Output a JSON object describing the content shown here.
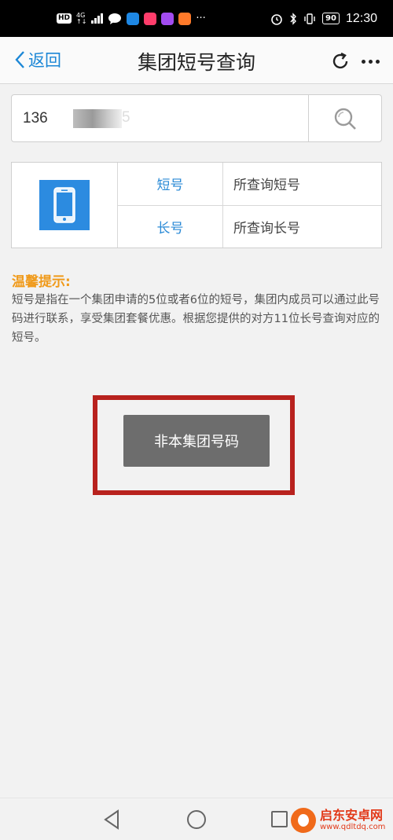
{
  "status_bar": {
    "hd_badge": "HD",
    "network_top": "4G",
    "network_bottom": "↑↓",
    "more_dots": "···",
    "battery": "90",
    "time": "12:30",
    "app_colors": [
      "#1e88e5",
      "#ff3d6b",
      "#a24cf0",
      "#ff7a2a"
    ]
  },
  "nav": {
    "back_label": "返回",
    "title": "集团短号查询"
  },
  "search": {
    "value_prefix": "136",
    "value_suffix": "5"
  },
  "result": {
    "rows": [
      {
        "label": "短号",
        "value": "所查询短号"
      },
      {
        "label": "长号",
        "value": "所查询长号"
      }
    ]
  },
  "tips": {
    "title": "温馨提示:",
    "body": "短号是指在一个集团申请的5位或者6位的短号，集团内成员可以通过此号码进行联系，享受集团套餐优惠。根据您提供的对方11位长号查询对应的短号。"
  },
  "action": {
    "button_label": "非本集团号码"
  },
  "watermark": {
    "name": "启东安卓网",
    "url": "www.qdltdq.com"
  },
  "colors": {
    "accent": "#1c87d6",
    "tip_title": "#f09a1a",
    "highlight": "#b8221e",
    "button": "#6d6d6d"
  }
}
